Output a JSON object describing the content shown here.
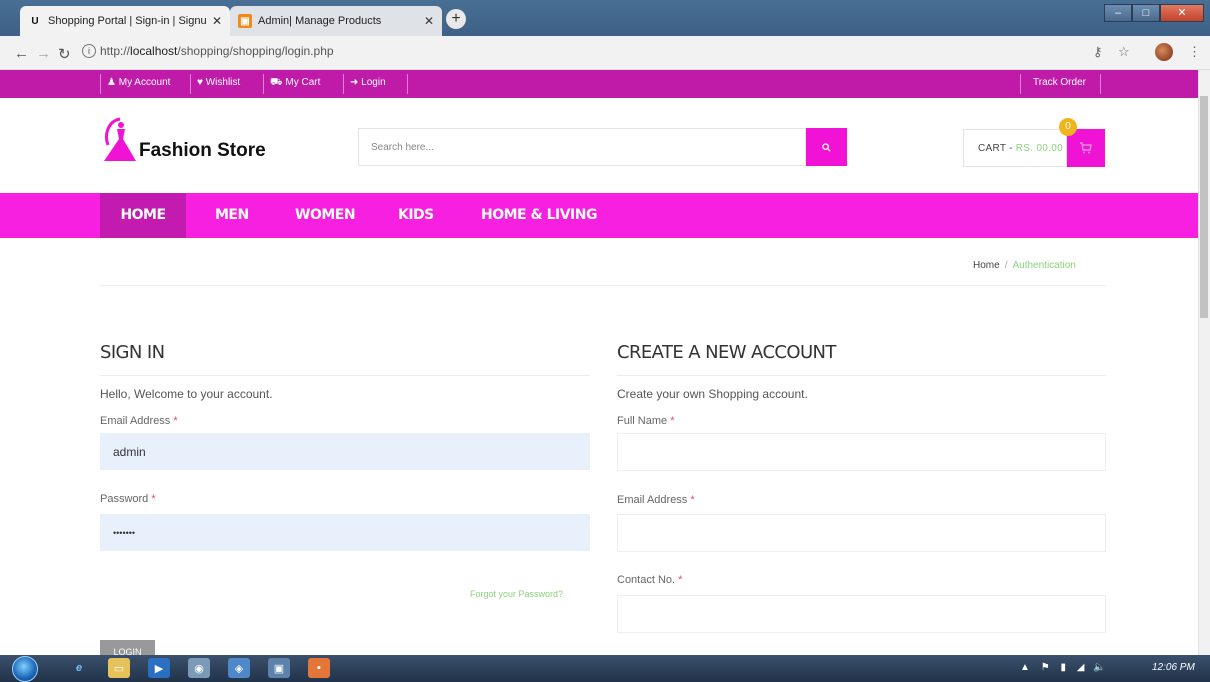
{
  "browser": {
    "tabs": [
      {
        "favicon": "U",
        "title": "Shopping Portal | Sign-in | Signu",
        "active": true
      },
      {
        "favicon": "admin-icon",
        "title": "Admin| Manage Products",
        "active": false
      }
    ],
    "url_prefix": "http://",
    "url_host": "localhost",
    "url_path": "/shopping/shopping/login.php"
  },
  "topbar": {
    "links": [
      {
        "icon": "user-icon",
        "label": "My Account"
      },
      {
        "icon": "heart-icon",
        "label": "Wishlist"
      },
      {
        "icon": "cart-icon",
        "label": "My Cart"
      },
      {
        "icon": "login-icon",
        "label": "Login"
      }
    ],
    "track_order": "Track Order"
  },
  "header": {
    "logo_text": "Fashion Store",
    "search_placeholder": "Search here...",
    "cart_label": "CART -",
    "cart_price": "RS. 00.00",
    "cart_count": "0"
  },
  "nav": {
    "items": [
      "HOME",
      "MEN",
      "WOMEN",
      "KIDS",
      "HOME & LIVING"
    ]
  },
  "breadcrumb": {
    "home": "Home",
    "current": "Authentication"
  },
  "signin": {
    "title": "SIGN IN",
    "welcome": "Hello, Welcome to your account.",
    "email_label": "Email Address",
    "email_value": "admin",
    "password_label": "Password",
    "password_value": "•••••••",
    "forgot": "Forgot your Password?",
    "login_button": "LOGIN"
  },
  "register": {
    "title": "CREATE A NEW ACCOUNT",
    "intro": "Create your own Shopping account.",
    "fullname_label": "Full Name",
    "email_label": "Email Address",
    "contact_label": "Contact No."
  },
  "required_mark": "*",
  "taskbar": {
    "clock": "12:06 PM"
  },
  "colors": {
    "brand_magenta": "#f71fe0",
    "topbar_magenta": "#c01aa8",
    "accent_green": "#8bd27a",
    "badge_yellow": "#f0b51c"
  }
}
